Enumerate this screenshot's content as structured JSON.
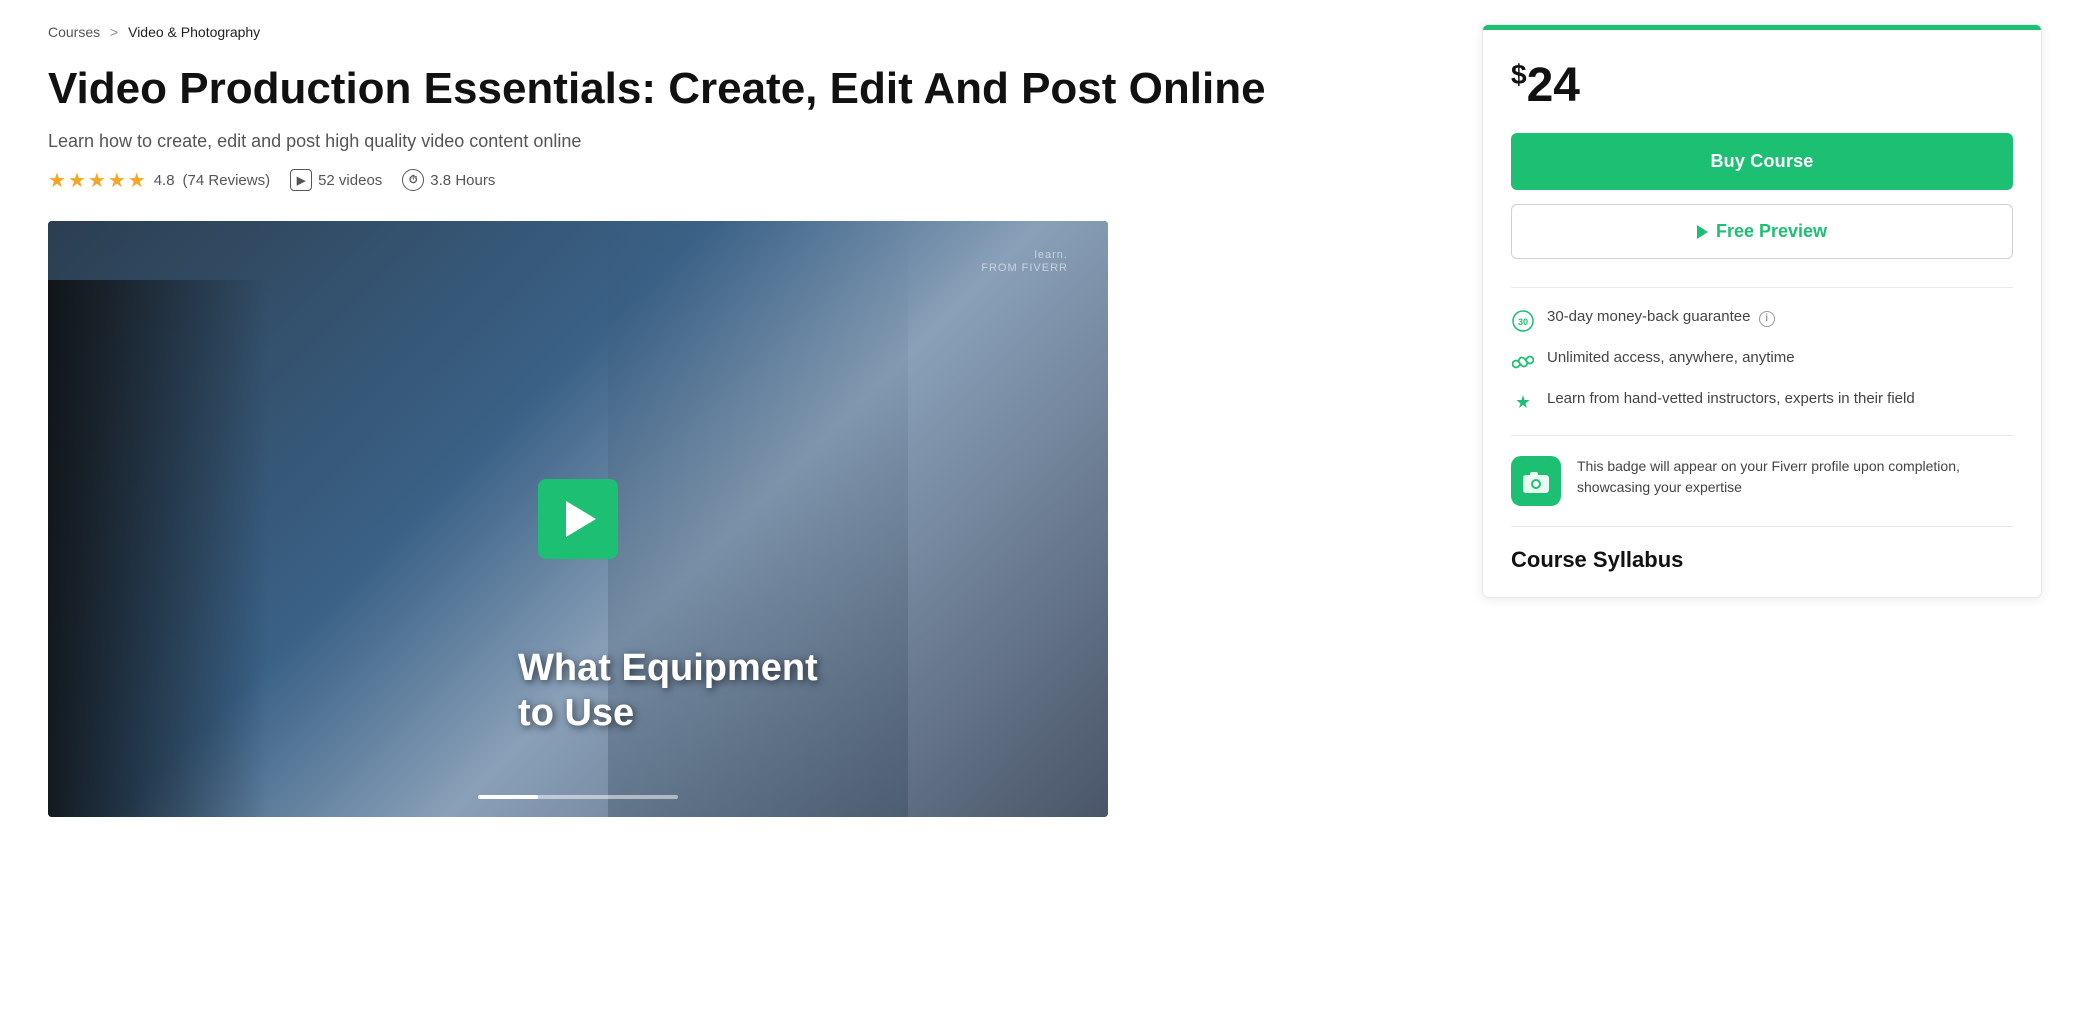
{
  "breadcrumb": {
    "parent": "Courses",
    "separator": ">",
    "current": "Video & Photography"
  },
  "course": {
    "title": "Video Production Essentials: Create, Edit And Post Online",
    "subtitle": "Learn how to create, edit and post high quality video content online",
    "rating": "4.8",
    "reviews": "(74 Reviews)",
    "videos": "52 videos",
    "hours": "3.8 Hours",
    "video_overlay_line1": "What Equipment",
    "video_overlay_line2": "to Use",
    "watermark_brand": "learn.",
    "watermark_sub": "FROM FIVERR"
  },
  "sidebar": {
    "price_symbol": "$",
    "price": "24",
    "buy_label": "Buy Course",
    "preview_label": "Free Preview",
    "features": [
      {
        "icon": "30-icon",
        "text": "30-day money-back guarantee",
        "has_info": true
      },
      {
        "icon": "infinity-icon",
        "text": "Unlimited access, anywhere, anytime",
        "has_info": false
      },
      {
        "icon": "star-icon",
        "text": "Learn from hand-vetted instructors, experts in their field",
        "has_info": false
      }
    ],
    "badge_text": "This badge will appear on your Fiverr profile upon completion, showcasing your expertise",
    "syllabus_title": "Course Syllabus"
  }
}
